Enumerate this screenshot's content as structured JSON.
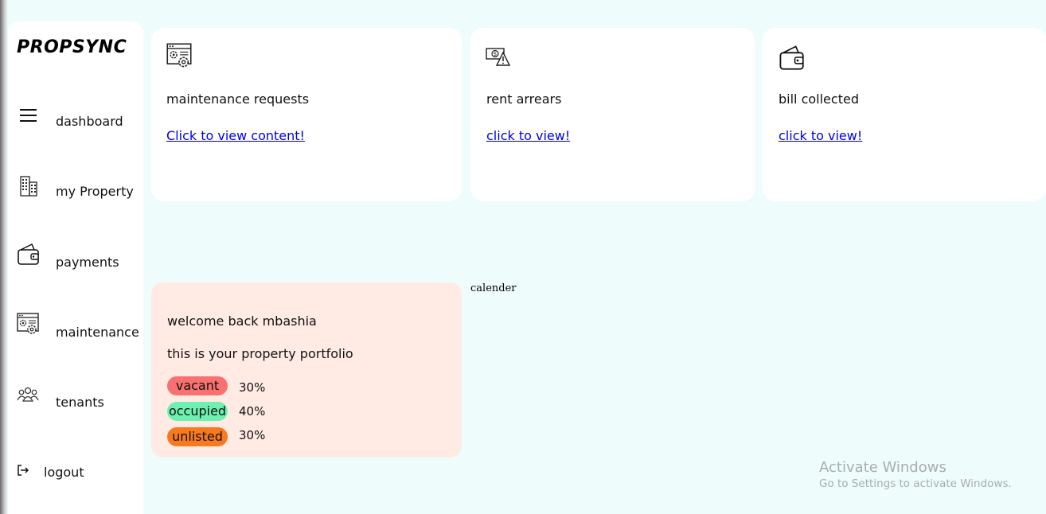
{
  "brand": "PROPSYNC",
  "sidebar": {
    "items": [
      {
        "label": "dashboard",
        "icon": "hamburger-menu-icon"
      },
      {
        "label": "my Property",
        "icon": "building-icon"
      },
      {
        "label": "payments",
        "icon": "wallet-icon"
      },
      {
        "label": "maintenance",
        "icon": "settings-window-icon"
      },
      {
        "label": "tenants",
        "icon": "people-group-icon"
      },
      {
        "label": "logout",
        "icon": "logout-icon"
      }
    ]
  },
  "cards": [
    {
      "title": "maintenance requests",
      "link": "Click to view content!",
      "icon": "settings-window-icon"
    },
    {
      "title": "rent arrears",
      "link": "click to view!",
      "icon": "money-warning-icon"
    },
    {
      "title": "bill collected",
      "link": "click to view!",
      "icon": "wallet-icon"
    }
  ],
  "welcome": {
    "greeting": "welcome back mbashia",
    "subtitle": "this is your property portfolio",
    "stats": [
      {
        "label": "vacant",
        "value": "30%",
        "color": "#f87171"
      },
      {
        "label": "occupied",
        "value": "40%",
        "color": "#6ef0b0"
      },
      {
        "label": "unlisted",
        "value": "30%",
        "color": "#f97a1e"
      }
    ]
  },
  "calendar_label": "calender",
  "watermark": {
    "title": "Activate Windows",
    "subtitle": "Go to Settings to activate Windows."
  }
}
